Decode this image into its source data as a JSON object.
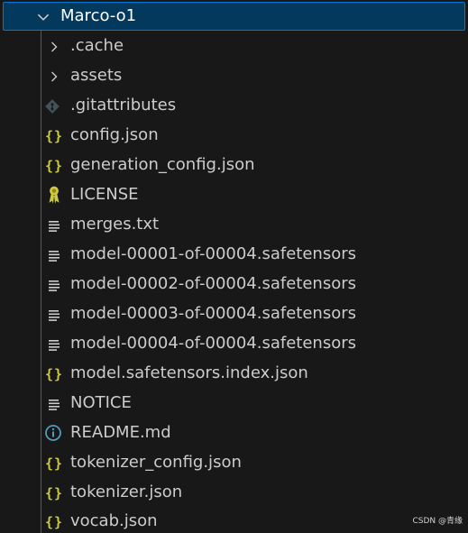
{
  "explorer": {
    "root": {
      "label": "Marco-o1",
      "icon": "chevron-down-icon",
      "expanded": true
    },
    "items": [
      {
        "label": ".cache",
        "icon": "chevron-right-icon",
        "kind": "folder"
      },
      {
        "label": "assets",
        "icon": "chevron-right-icon",
        "kind": "folder"
      },
      {
        "label": ".gitattributes",
        "icon": "git-icon",
        "kind": "file"
      },
      {
        "label": "config.json",
        "icon": "json-icon",
        "kind": "file",
        "icon_text": "{}"
      },
      {
        "label": "generation_config.json",
        "icon": "json-icon",
        "kind": "file",
        "icon_text": "{}"
      },
      {
        "label": "LICENSE",
        "icon": "license-icon",
        "kind": "file"
      },
      {
        "label": "merges.txt",
        "icon": "text-file-icon",
        "kind": "file"
      },
      {
        "label": "model-00001-of-00004.safetensors",
        "icon": "text-file-icon",
        "kind": "file"
      },
      {
        "label": "model-00002-of-00004.safetensors",
        "icon": "text-file-icon",
        "kind": "file"
      },
      {
        "label": "model-00003-of-00004.safetensors",
        "icon": "text-file-icon",
        "kind": "file"
      },
      {
        "label": "model-00004-of-00004.safetensors",
        "icon": "text-file-icon",
        "kind": "file"
      },
      {
        "label": "model.safetensors.index.json",
        "icon": "json-icon",
        "kind": "file",
        "icon_text": "{}"
      },
      {
        "label": "NOTICE",
        "icon": "text-file-icon",
        "kind": "file"
      },
      {
        "label": "README.md",
        "icon": "info-icon",
        "kind": "file"
      },
      {
        "label": "tokenizer_config.json",
        "icon": "json-icon",
        "kind": "file",
        "icon_text": "{}"
      },
      {
        "label": "tokenizer.json",
        "icon": "json-icon",
        "kind": "file",
        "icon_text": "{}"
      },
      {
        "label": "vocab.json",
        "icon": "json-icon",
        "kind": "file",
        "icon_text": "{}"
      }
    ]
  },
  "watermark": "CSDN @青缘",
  "colors": {
    "background": "#181818",
    "selection": "#04395e",
    "focus_border": "#0078d4",
    "text": "#cccccc",
    "json_icon": "#cbcb41",
    "info_icon": "#519aba",
    "git_icon": "#41535b",
    "license_icon": "#cbcb41"
  }
}
